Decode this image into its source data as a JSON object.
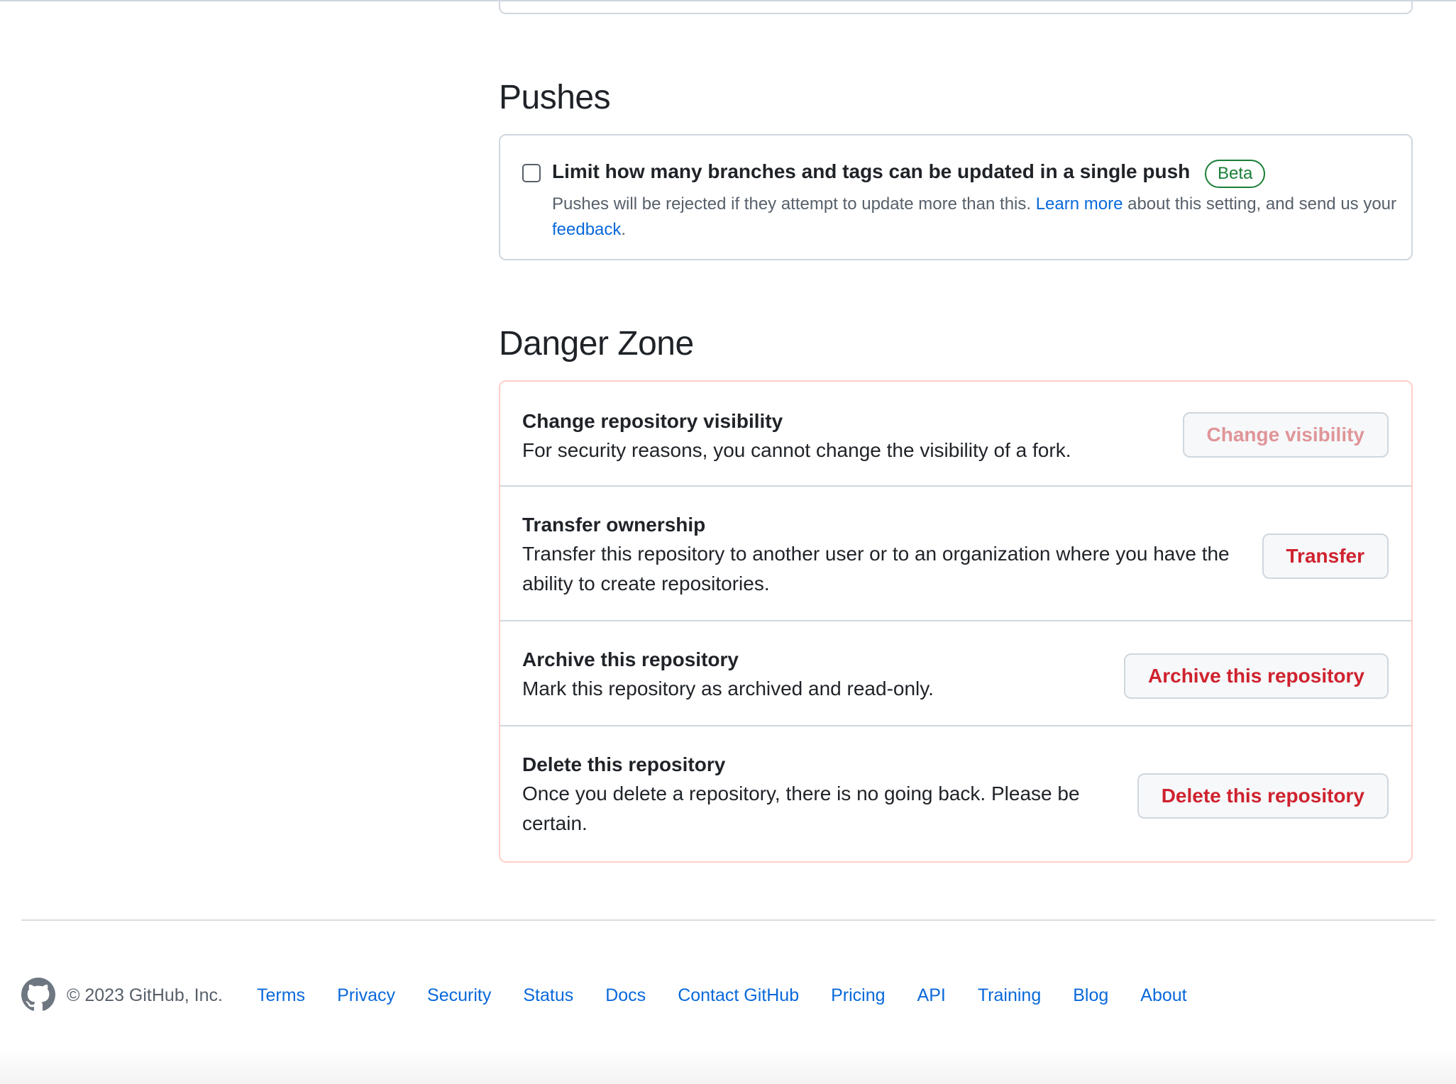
{
  "pushes": {
    "title": "Pushes",
    "limit_label": "Limit how many branches and tags can be updated in a single push",
    "limit_checked": false,
    "badge": "Beta",
    "desc_before": "Pushes will be rejected if they attempt to update more than this. ",
    "learn_more": "Learn more",
    "desc_middle": " about this setting, and send us your ",
    "feedback": "feedback",
    "desc_end": "."
  },
  "danger": {
    "title": "Danger Zone",
    "rows": [
      {
        "title": "Change repository visibility",
        "desc": "For security reasons, you cannot change the visibility of a fork.",
        "button": "Change visibility"
      },
      {
        "title": "Transfer ownership",
        "desc": "Transfer this repository to another user or to an organization where you have the ability to create repositories.",
        "button": "Transfer"
      },
      {
        "title": "Archive this repository",
        "desc": "Mark this repository as archived and read-only.",
        "button": "Archive this repository"
      },
      {
        "title": "Delete this repository",
        "desc": "Once you delete a repository, there is no going back. Please be certain.",
        "button": "Delete this repository"
      }
    ]
  },
  "footer": {
    "logo_icon": "github-mark-icon",
    "copyright": "© 2023 GitHub, Inc.",
    "links": [
      "Terms",
      "Privacy",
      "Security",
      "Status",
      "Docs",
      "Contact GitHub",
      "Pricing",
      "API",
      "Training",
      "Blog",
      "About"
    ]
  },
  "colors": {
    "danger": "#cf222e",
    "danger_border": "#ffcecb",
    "link": "#0969da",
    "success": "#1a7f37"
  }
}
